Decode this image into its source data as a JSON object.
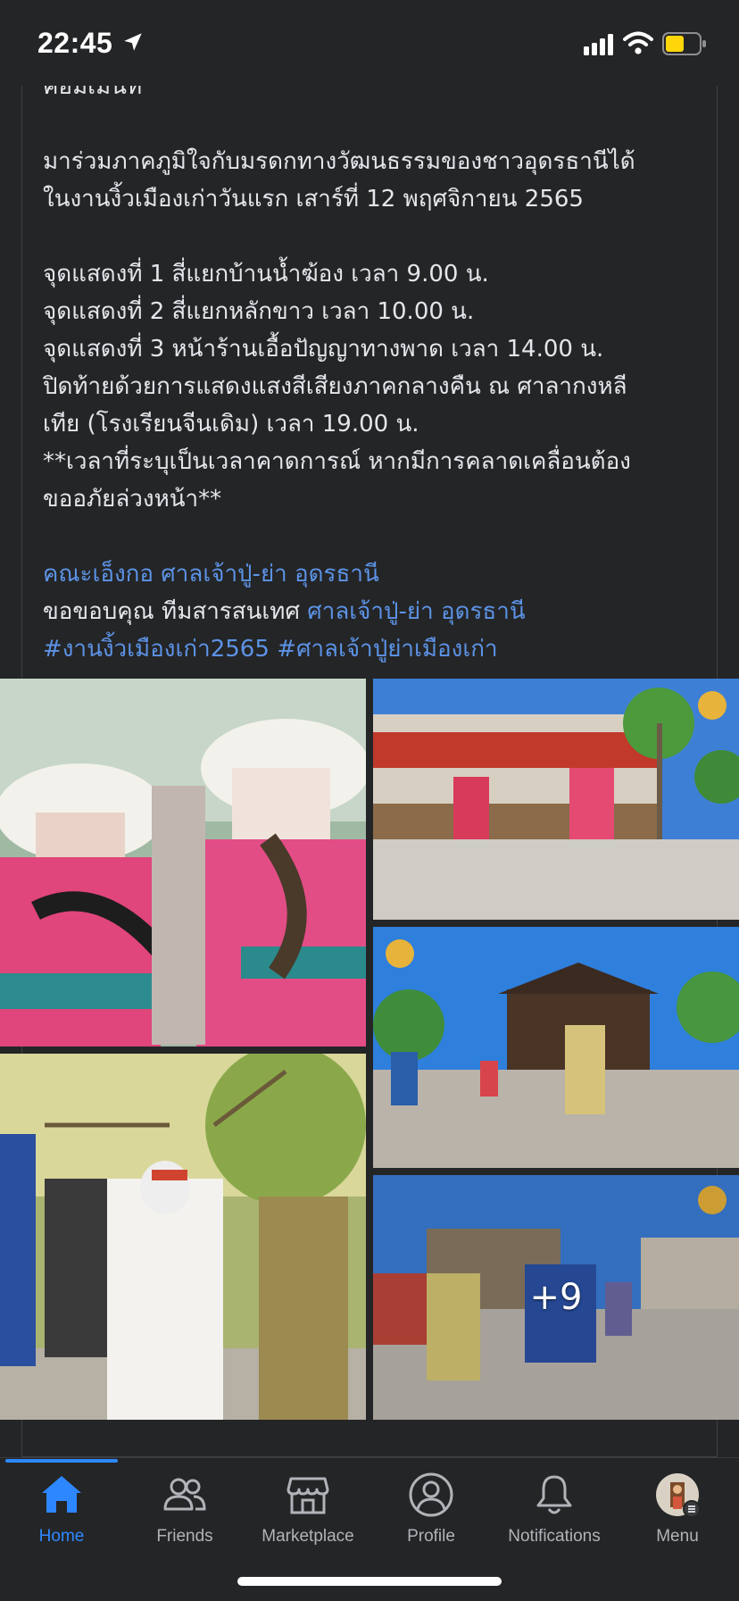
{
  "status_bar": {
    "time": "22:45"
  },
  "post": {
    "text_lines": [
      "คอมเมนท์",
      "",
      "มาร่วมภาคภูมิใจกับมรดกทางวัฒนธรรมของชาวอุดรธานีได้",
      "ในงานงิ้วเมืองเก่าวันแรก เสาร์ที่ 12 พฤศจิกายน 2565",
      "",
      "จุดแสดงที่ 1 สี่แยกบ้านน้ำฆ้อง เวลา 9.00 น.",
      "จุดแสดงที่ 2 สี่แยกหลักขาว เวลา 10.00 น.",
      "จุดแสดงที่ 3 หน้าร้านเอื้อปัญญาทางพาด เวลา 14.00 น.",
      "ปิดท้ายด้วยการแสดงแสงสีเสียงภาคกลางคืน ณ ศาลากงหลี",
      "เทีย (โรงเรียนจีนเดิม) เวลา 19.00 น.",
      "**เวลาที่ระบุเป็นเวลาคาดการณ์ หากมีการคลาดเคลื่อนต้อง",
      "ขออภัยล่วงหน้า**",
      ""
    ],
    "credit_link_1": "คณะเอ็งกอ ศาลเจ้าปู่-ย่า อุดรธานี",
    "thanks_prefix": "ขอขอบคุณ ทีมสารสนเทศ",
    "credit_link_2": "ศาลเจ้าปู่-ย่า อุดรธานี",
    "hashtag_1": "#งานงิ้วเมืองเก่า2565",
    "hashtag_2": "#ศาลเจ้าปู่ย่าเมืองเก่า",
    "more_photos_label": "+9"
  },
  "tabbar": {
    "tabs": [
      {
        "label": "Home",
        "icon": "home-icon",
        "active": true
      },
      {
        "label": "Friends",
        "icon": "friends-icon"
      },
      {
        "label": "Marketplace",
        "icon": "marketplace-icon"
      },
      {
        "label": "Profile",
        "icon": "profile-icon"
      },
      {
        "label": "Notifications",
        "icon": "bell-icon"
      },
      {
        "label": "Menu",
        "icon": "avatar-menu-icon"
      }
    ]
  },
  "colors": {
    "background": "#242527",
    "text": "#e4e6eb",
    "link": "#5c93e6",
    "accent": "#2d88ff",
    "tab_inactive": "#b0b3b8"
  }
}
